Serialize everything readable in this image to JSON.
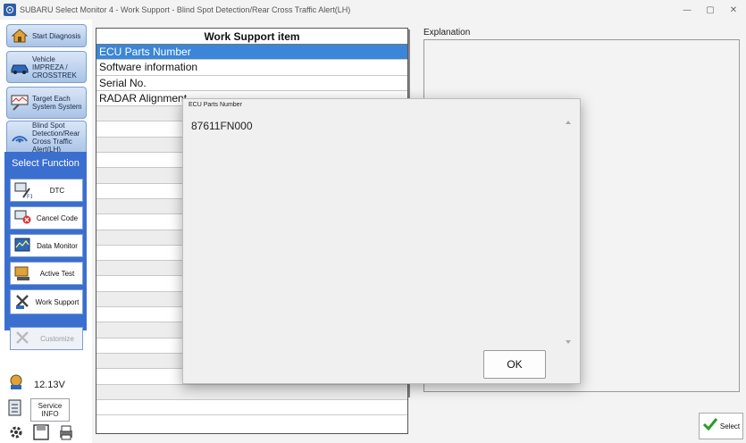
{
  "window": {
    "title": "SUBARU Select Monitor 4 - Work Support - Blind Spot Detection/Rear Cross Traffic Alert(LH)",
    "controls": [
      "—",
      "▢",
      "✕"
    ]
  },
  "sidebar": {
    "nav": [
      {
        "label": "Start Diagnosis",
        "icon": "house-icon"
      },
      {
        "label": "Vehicle IMPREZA / CROSSTREK",
        "icon": "car-icon"
      },
      {
        "label": "Target Each System System",
        "icon": "system-icon"
      },
      {
        "label": "Blind Spot Detection/Rear Cross Traffic Alert(LH)",
        "icon": "radar-icon"
      }
    ],
    "select_function": {
      "heading": "Select Function",
      "items": [
        {
          "label": "DTC",
          "icon": "dtc-icon",
          "enabled": true
        },
        {
          "label": "Cancel Code",
          "icon": "cancel-code-icon",
          "enabled": true
        },
        {
          "label": "Data Monitor",
          "icon": "data-monitor-icon",
          "enabled": true
        },
        {
          "label": "Active Test",
          "icon": "active-test-icon",
          "enabled": true
        },
        {
          "label": "Work Support",
          "icon": "work-support-icon",
          "enabled": true
        },
        {
          "label": "Customize",
          "icon": "customize-icon",
          "enabled": false
        }
      ]
    },
    "voltage": "12.13V",
    "service_info": "Service INFO"
  },
  "work_support": {
    "header": "Work Support item",
    "items": [
      {
        "label": "ECU Parts Number",
        "selected": true
      },
      {
        "label": "Software information",
        "selected": false
      },
      {
        "label": "Serial No.",
        "selected": false
      },
      {
        "label": "RADAR Alignment",
        "selected": false
      }
    ],
    "blank_rows": 20
  },
  "explanation": {
    "label": "Explanation"
  },
  "select_button": {
    "label": "Select"
  },
  "dialog": {
    "title": "ECU Parts Number",
    "value": "87611FN000",
    "ok_label": "OK"
  },
  "colors": {
    "selected_row": "#3b86d8",
    "function_panel": "#3a6fd0",
    "nav_button": "#a9c3e6"
  }
}
